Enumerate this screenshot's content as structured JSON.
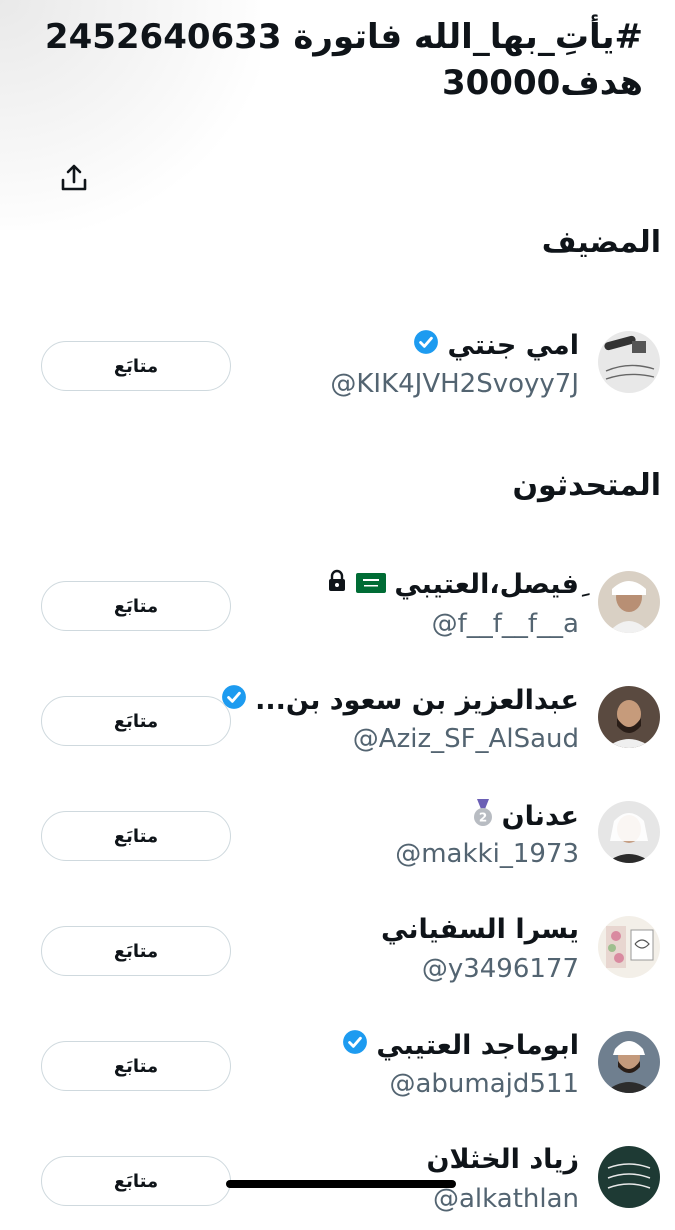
{
  "space_title": "#يأتِ_بها_الله فاتورة 2452640633 هدف30000",
  "sections": {
    "host": "المضيف",
    "speakers": "المتحدثون"
  },
  "follow_label": "متابَع",
  "host": {
    "name": "امي جنتي",
    "handle": "@KIK4JVH2Svoyy7J",
    "badge": "verified-icon"
  },
  "speakers": [
    {
      "name": "ِفيصل،العتيبي",
      "handle": "@f__f__f__a",
      "badge": "saudi-flag-icon, lock-icon"
    },
    {
      "name": "عبدالعزيز بن سعود بن...",
      "handle": "@Aziz_SF_AlSaud",
      "badge": "verified-icon"
    },
    {
      "name": "عدنان",
      "handle": "@makki_1973",
      "badge": "medal-2-icon"
    },
    {
      "name": "يسرا السفياني",
      "handle": "@y3496177",
      "badge": ""
    },
    {
      "name": "ابوماجد العتيبي",
      "handle": "@abumajd511",
      "badge": "verified-icon"
    },
    {
      "name": "زياد الخثلان",
      "handle": "@alkathlan",
      "badge": ""
    }
  ],
  "colors": {
    "verified": "#1d9bf0",
    "text": "#0f1419",
    "secondary": "#536471",
    "button_border": "#cfd9de"
  }
}
